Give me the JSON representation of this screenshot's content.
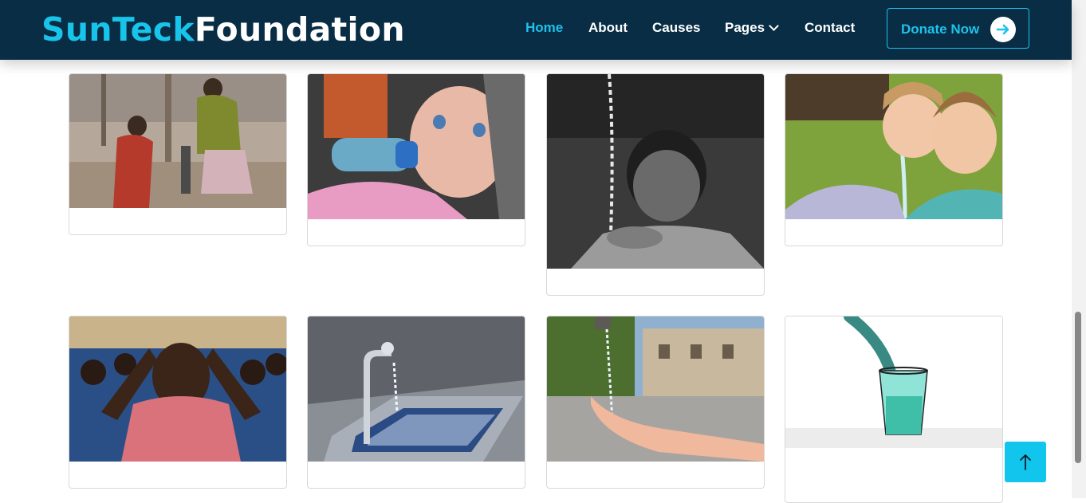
{
  "brand": {
    "part1": "SunTeck",
    "part2": "Foundation"
  },
  "nav": {
    "home": "Home",
    "about": "About",
    "causes": "Causes",
    "pages": "Pages",
    "contact": "Contact"
  },
  "donate_label": "Donate Now",
  "colors": {
    "header_bg": "#082d44",
    "accent": "#1ec2ec",
    "to_top_bg": "#11c5ec"
  },
  "icons": {
    "donate": "arrow-right-icon",
    "pages": "chevron-down-icon",
    "to_top": "arrow-up-icon"
  },
  "gallery": [
    {
      "photo": "women-at-water-pump"
    },
    {
      "photo": "baby-drinking-from-bottle"
    },
    {
      "photo": "boy-drinking-from-stream"
    },
    {
      "photo": "children-drinking-from-fountain"
    },
    {
      "photo": "children-with-hands-on-head"
    },
    {
      "photo": "water-tap-over-basin"
    },
    {
      "photo": "hand-under-fountain-spout"
    },
    {
      "photo": "water-poured-into-glass"
    }
  ]
}
